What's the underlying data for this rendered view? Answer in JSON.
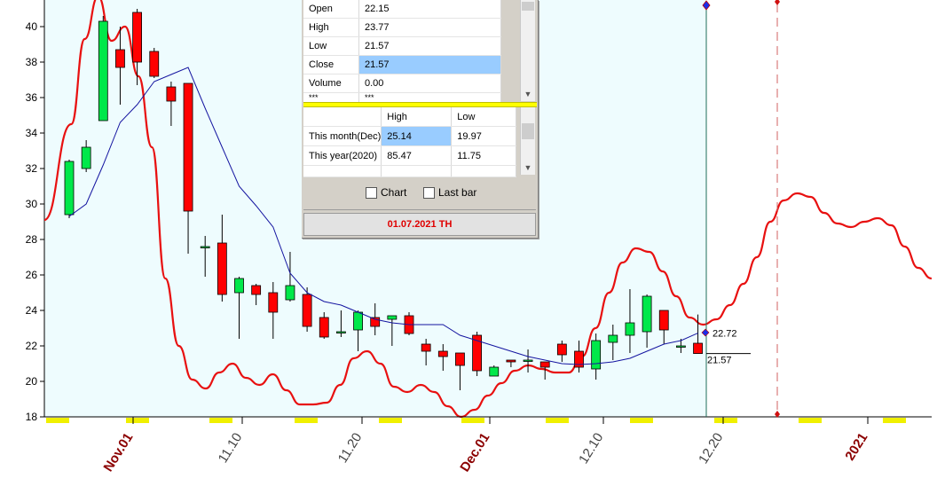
{
  "chart_data": {
    "type": "candlestick",
    "ylim": [
      18,
      41.5
    ],
    "yticks": [
      18,
      20,
      22,
      24,
      26,
      28,
      30,
      32,
      34,
      36,
      38,
      40
    ],
    "xlabels": [
      {
        "label": "Nov.01",
        "month_mark": true
      },
      {
        "label": "11.10",
        "month_mark": false
      },
      {
        "label": "11.20",
        "month_mark": false
      },
      {
        "label": "Dec.01",
        "month_mark": true
      },
      {
        "label": "12.10",
        "month_mark": false
      },
      {
        "label": "12.20",
        "month_mark": false
      },
      {
        "label": "2021",
        "month_mark": true
      }
    ],
    "candles": [
      {
        "o": 29.4,
        "h": 32.5,
        "l": 29.2,
        "c": 32.4
      },
      {
        "o": 32.0,
        "h": 33.6,
        "l": 31.8,
        "c": 33.2
      },
      {
        "o": 34.7,
        "h": 40.6,
        "l": 34.7,
        "c": 40.3
      },
      {
        "o": 38.7,
        "h": 40.0,
        "l": 35.6,
        "c": 37.7
      },
      {
        "o": 40.8,
        "h": 41.0,
        "l": 36.7,
        "c": 38.0
      },
      {
        "o": 38.6,
        "h": 38.8,
        "l": 37.1,
        "c": 37.2
      },
      {
        "o": 36.6,
        "h": 36.9,
        "l": 34.4,
        "c": 35.8
      },
      {
        "o": 36.8,
        "h": 36.8,
        "l": 27.2,
        "c": 29.6
      },
      {
        "o": 27.6,
        "h": 28.2,
        "l": 25.9,
        "c": 27.6
      },
      {
        "o": 27.8,
        "h": 29.4,
        "l": 24.5,
        "c": 24.9
      },
      {
        "o": 25.0,
        "h": 25.9,
        "l": 22.4,
        "c": 25.8
      },
      {
        "o": 25.4,
        "h": 25.5,
        "l": 24.3,
        "c": 24.9
      },
      {
        "o": 25.0,
        "h": 25.6,
        "l": 22.4,
        "c": 23.9
      },
      {
        "o": 24.6,
        "h": 27.3,
        "l": 24.5,
        "c": 25.4
      },
      {
        "o": 24.9,
        "h": 25.3,
        "l": 22.8,
        "c": 23.1
      },
      {
        "o": 23.6,
        "h": 23.9,
        "l": 22.4,
        "c": 22.5
      },
      {
        "o": 22.8,
        "h": 24.0,
        "l": 22.5,
        "c": 22.8
      },
      {
        "o": 22.9,
        "h": 24.0,
        "l": 21.7,
        "c": 23.9
      },
      {
        "o": 23.6,
        "h": 24.4,
        "l": 22.6,
        "c": 23.1
      },
      {
        "o": 23.5,
        "h": 23.7,
        "l": 22.0,
        "c": 23.7
      },
      {
        "o": 23.7,
        "h": 23.9,
        "l": 22.6,
        "c": 22.7
      },
      {
        "o": 22.1,
        "h": 22.4,
        "l": 20.9,
        "c": 21.7
      },
      {
        "o": 21.7,
        "h": 22.1,
        "l": 20.6,
        "c": 21.4
      },
      {
        "o": 21.6,
        "h": 21.6,
        "l": 19.5,
        "c": 20.9
      },
      {
        "o": 22.6,
        "h": 22.8,
        "l": 20.3,
        "c": 20.6
      },
      {
        "o": 20.3,
        "h": 20.9,
        "l": 20.3,
        "c": 20.8
      },
      {
        "o": 21.2,
        "h": 21.2,
        "l": 20.8,
        "c": 21.1
      },
      {
        "o": 21.2,
        "h": 21.8,
        "l": 20.5,
        "c": 21.2
      },
      {
        "o": 21.1,
        "h": 21.1,
        "l": 20.1,
        "c": 20.8
      },
      {
        "o": 22.1,
        "h": 22.3,
        "l": 21.1,
        "c": 21.5
      },
      {
        "o": 21.7,
        "h": 22.3,
        "l": 20.5,
        "c": 20.8
      },
      {
        "o": 20.7,
        "h": 22.7,
        "l": 20.1,
        "c": 22.3
      },
      {
        "o": 22.2,
        "h": 23.2,
        "l": 21.2,
        "c": 22.6
      },
      {
        "o": 22.6,
        "h": 25.2,
        "l": 21.6,
        "c": 23.3
      },
      {
        "o": 22.8,
        "h": 24.9,
        "l": 21.9,
        "c": 24.8
      },
      {
        "o": 24.0,
        "h": 24.0,
        "l": 22.1,
        "c": 22.9
      },
      {
        "o": 22.0,
        "h": 22.4,
        "l": 21.6,
        "c": 22.0
      },
      {
        "o": 22.15,
        "h": 23.77,
        "l": 21.57,
        "c": 21.57
      }
    ],
    "ma_line": [
      29.3,
      30.0,
      32.2,
      34.6,
      35.6,
      36.9,
      37.3,
      37.7,
      35.4,
      33.2,
      31.0,
      29.9,
      28.7,
      26.1,
      25.0,
      24.5,
      24.3,
      23.9,
      23.5,
      23.3,
      23.2,
      23.2,
      23.2,
      22.6,
      22.3,
      22.0,
      21.7,
      21.4,
      21.2,
      21.0,
      20.95,
      21.0,
      21.1,
      21.3,
      21.7,
      22.1,
      22.3,
      22.72
    ],
    "band_upper": [
      [
        0,
        29.1
      ],
      [
        2,
        34.5
      ],
      [
        3,
        39.3
      ],
      [
        4,
        41.7
      ],
      [
        5,
        39.2
      ],
      [
        6,
        40.0
      ],
      [
        7,
        37.2
      ],
      [
        8,
        33.2
      ],
      [
        9,
        25.8
      ],
      [
        10,
        22.0
      ],
      [
        11,
        20.1
      ],
      [
        12,
        19.6
      ],
      [
        13,
        20.5
      ],
      [
        14,
        21.0
      ],
      [
        15,
        20.2
      ],
      [
        16,
        19.8
      ],
      [
        17,
        20.4
      ],
      [
        18,
        19.5
      ],
      [
        19,
        18.7
      ],
      [
        20,
        18.7
      ],
      [
        21,
        18.8
      ],
      [
        22,
        19.8
      ],
      [
        23,
        21.3
      ],
      [
        24,
        21.7
      ],
      [
        25,
        21.0
      ],
      [
        26,
        19.7
      ],
      [
        27,
        19.4
      ],
      [
        28,
        19.8
      ],
      [
        29,
        19.4
      ],
      [
        30,
        18.6
      ],
      [
        31,
        18.0
      ],
      [
        32,
        18.4
      ],
      [
        33,
        19.2
      ],
      [
        34,
        19.9
      ],
      [
        35,
        20.6
      ],
      [
        36,
        20.9
      ],
      [
        37,
        20.7
      ],
      [
        38,
        20.5
      ],
      [
        39,
        20.5
      ],
      [
        40,
        21.4
      ],
      [
        41,
        23.0
      ],
      [
        42,
        25.0
      ],
      [
        43,
        26.7
      ],
      [
        44,
        27.5
      ],
      [
        45,
        27.3
      ],
      [
        46,
        26.2
      ],
      [
        47,
        24.8
      ],
      [
        48,
        23.6
      ],
      [
        49,
        23.2
      ],
      [
        50,
        23.5
      ],
      [
        51,
        24.3
      ],
      [
        52,
        25.5
      ],
      [
        53,
        27.0
      ],
      [
        54,
        29.0
      ],
      [
        55,
        30.2
      ],
      [
        56,
        30.6
      ],
      [
        57,
        30.4
      ],
      [
        58,
        29.5
      ],
      [
        59,
        28.9
      ],
      [
        60,
        28.7
      ],
      [
        61,
        29.0
      ],
      [
        62,
        29.2
      ],
      [
        63,
        28.8
      ],
      [
        64,
        27.6
      ],
      [
        65,
        26.4
      ],
      [
        66,
        25.8
      ]
    ],
    "last_close_label": "21.57",
    "ma_label": "22.72"
  },
  "panel": {
    "ohlc_rows": [
      {
        "label": "Open",
        "value": "22.15"
      },
      {
        "label": "High",
        "value": "23.77"
      },
      {
        "label": "Low",
        "value": "21.57"
      },
      {
        "label": "Close",
        "value": "21.57"
      },
      {
        "label": "Volume",
        "value": "0.00"
      },
      {
        "label": "***",
        "value": "***"
      }
    ],
    "period_header": {
      "c0": "",
      "c1": "High",
      "c2": "Low"
    },
    "period_rows": [
      {
        "label": "This month(Dec)",
        "high": "25.14",
        "low": "19.97"
      },
      {
        "label": "This year(2020)",
        "high": "85.47",
        "low": "11.75"
      }
    ],
    "chart_checkbox_label": "Chart",
    "lastbar_checkbox_label": "Last bar",
    "date_text": "01.07.2021 TH"
  },
  "colors": {
    "up": "#00e84a",
    "down": "#ff0000",
    "band": "#e81010",
    "ma": "#1414a0",
    "shade": "#eefcfe",
    "yellow": "#f0f000",
    "month_label": "#8b0000",
    "day_label": "#444444"
  }
}
